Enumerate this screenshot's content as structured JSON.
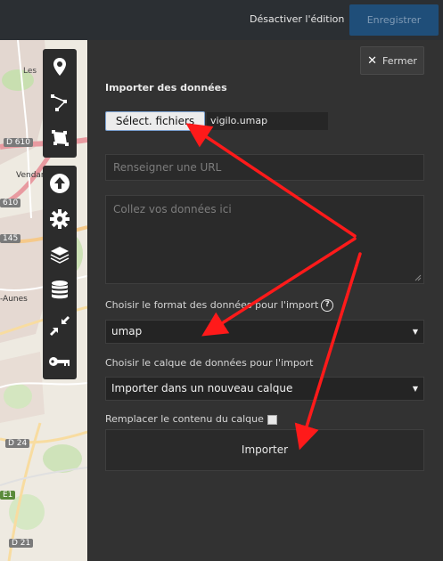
{
  "header": {
    "disable_edit_label": "Désactiver l'édition",
    "save_label": "Enregistrer"
  },
  "map": {
    "labels": [
      "Les",
      "D 610",
      "Vendar",
      "610",
      "145",
      "-Aunes",
      "D 24",
      "E1",
      "D 21"
    ],
    "toolbar_top": [
      "marker-icon",
      "polyline-icon",
      "polygon-icon"
    ],
    "toolbar_bottom": [
      "upload-icon",
      "gear-icon",
      "layers-icon",
      "database-icon",
      "shrink-icon",
      "key-icon"
    ]
  },
  "panel": {
    "close_label": "Fermer",
    "title": "Importer des données",
    "file_button_label": "Sélect. fichiers",
    "file_name": "vigilo.umap",
    "url_placeholder": "Renseigner une URL",
    "paste_placeholder": "Collez vos données ici",
    "format_label": "Choisir le format des données pour l'import",
    "format_value": "umap",
    "layer_label": "Choisir le calque de données pour l'import",
    "layer_value": "Importer dans un nouveau calque",
    "replace_label": "Remplacer le contenu du calque",
    "import_label": "Importer"
  },
  "colors": {
    "annotation_arrow": "#ff1a1a",
    "save_button": "#1f4e79",
    "panel_bg": "#323232"
  }
}
